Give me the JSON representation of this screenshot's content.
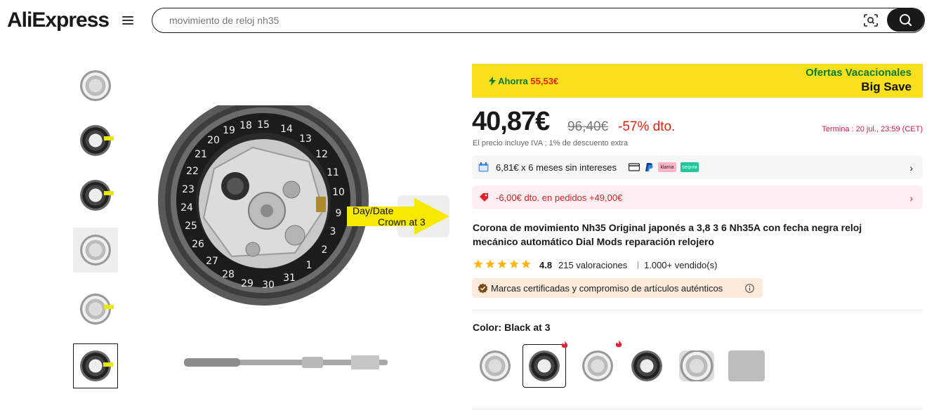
{
  "header": {
    "logo": "AliExpress",
    "search_placeholder": "movimiento de reloj nh35"
  },
  "product_image": {
    "callout_line1": "Day/Date",
    "callout_line2": "Crown at 3"
  },
  "promo": {
    "save_label": "Ahorra",
    "save_amount": "55,53€",
    "title": "Ofertas Vacacionales",
    "subtitle": "Big Save"
  },
  "pricing": {
    "price": "40,87€",
    "old_price": "96,40€",
    "discount": "-57% dto.",
    "ends": "Termina :  20 jul., 23:59 (CET)",
    "vat_note": "El precio incluye IVA ; 1% de descuento extra"
  },
  "payment": {
    "installments": "6,81€ x 6 meses sin intereses",
    "badges": [
      "klarna",
      "sequra"
    ]
  },
  "coupon": {
    "text": "-6,00€ dto. en pedidos +49,00€"
  },
  "product": {
    "title": "Corona de movimiento Nh35 Original japonés a 3,8 3 6 Nh35A con fecha negra reloj mecánico automático Dial Mods reparación relojero",
    "rating": "4.8",
    "reviews": "215 valoraciones",
    "sold": "1.000+ vendido(s)",
    "authentic": "Marcas certificadas y compromiso de artículos auténticos"
  },
  "variant": {
    "label": "Color: Black at 3",
    "options_count": 6,
    "selected_index": 1
  },
  "colors": {
    "accent_red": "#e0230f",
    "promo_yellow": "#f9e01d",
    "promo_green": "#0b7a33",
    "star_yellow": "#fdb818"
  }
}
